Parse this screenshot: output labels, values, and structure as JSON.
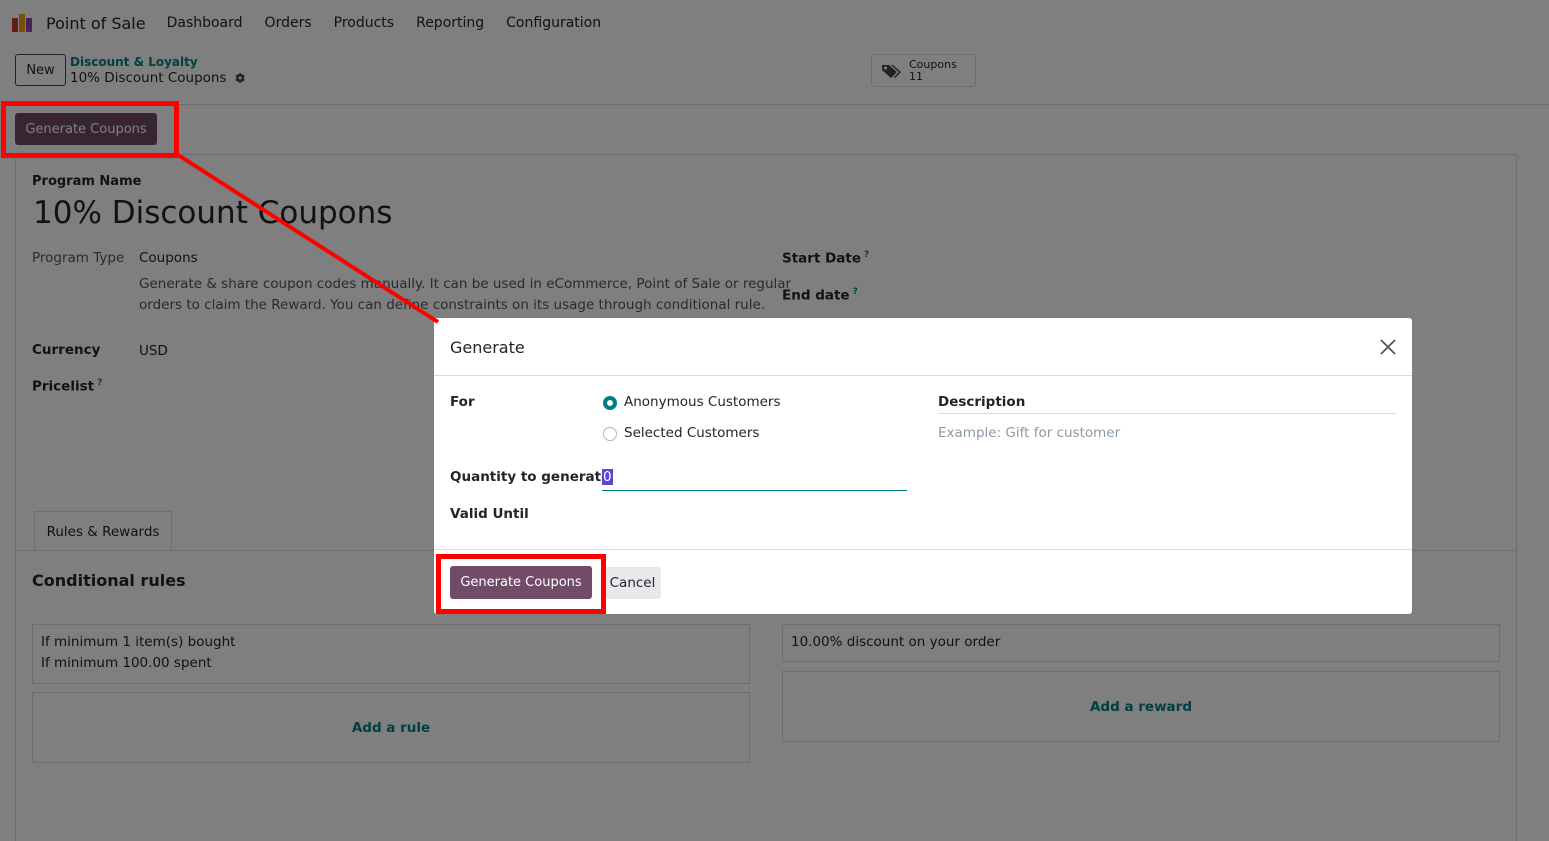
{
  "app": {
    "name": "Point of Sale",
    "menu": [
      "Dashboard",
      "Orders",
      "Products",
      "Reporting",
      "Configuration"
    ]
  },
  "control_panel": {
    "new_label": "New",
    "breadcrumb_parent": "Discount & Loyalty",
    "breadcrumb_current": "10% Discount Coupons",
    "smart_button": {
      "label": "Coupons",
      "count": "11"
    }
  },
  "status_bar": {
    "generate_label": "Generate Coupons"
  },
  "form": {
    "program_name_label": "Program Name",
    "program_name": "10% Discount Coupons",
    "program_type_label": "Program Type",
    "program_type": "Coupons",
    "program_type_help_1": "Generate & share coupon codes manually. It can be used in eCommerce, Point of Sale or regular",
    "program_type_help_2": "orders to claim the Reward. You can define constraints on its usage through conditional rule.",
    "currency_label": "Currency",
    "currency": "USD",
    "pricelist_label": "Pricelist",
    "start_date_label": "Start Date",
    "end_date_label": "End date",
    "help_mark": "?",
    "tab_label": "Rules & Rewards",
    "conditional_rules_title": "Conditional rules",
    "rule_line_1": "If minimum 1 item(s) bought",
    "rule_line_2": "If minimum 100.00 spent",
    "add_rule": "Add a rule",
    "reward_line": "10.00% discount on your order",
    "add_reward": "Add a reward"
  },
  "dialog": {
    "title": "Generate",
    "for_label": "For",
    "option_anonymous": "Anonymous Customers",
    "option_selected": "Selected Customers",
    "selected_option": "Anonymous Customers",
    "description_label": "Description",
    "description_placeholder": "Example: Gift for customer",
    "quantity_label": "Quantity to generate",
    "quantity_value": "0",
    "valid_until_label": "Valid Until",
    "generate_button": "Generate Coupons",
    "cancel_button": "Cancel"
  },
  "colors": {
    "primary": "#714b67",
    "accent": "#017e84",
    "annotation": "#ff0000"
  }
}
